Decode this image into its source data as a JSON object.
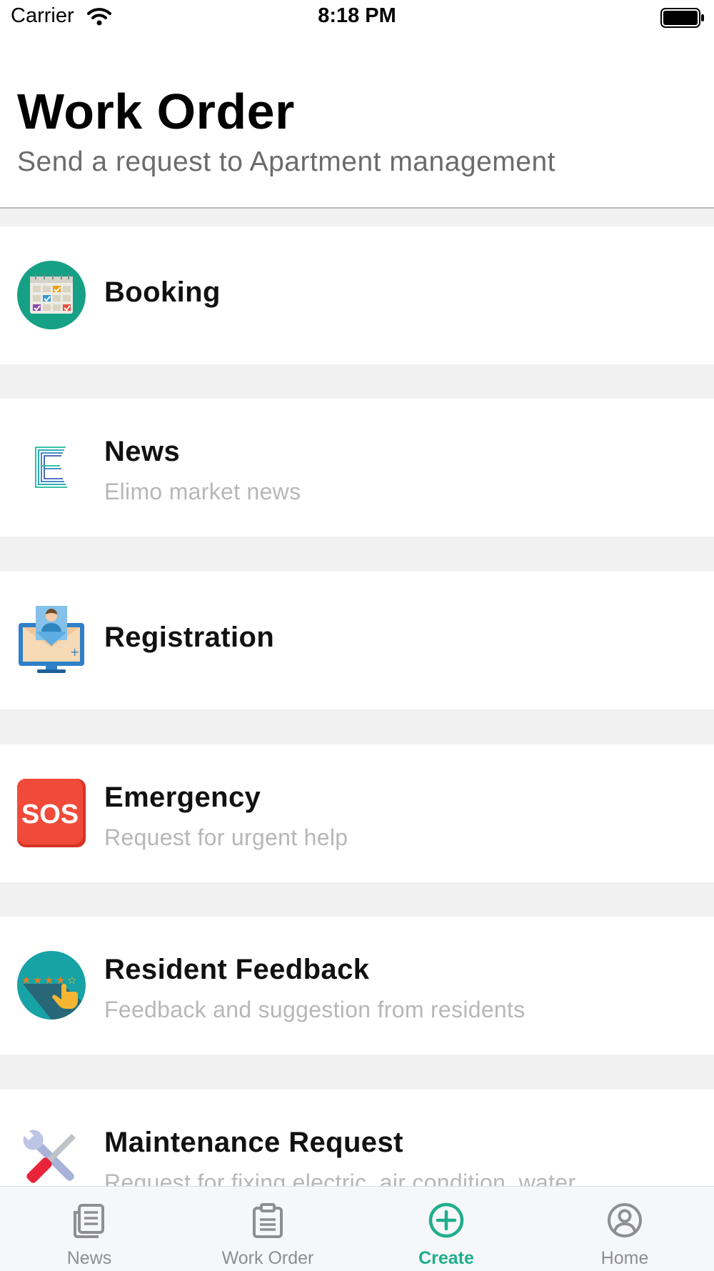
{
  "status_bar": {
    "carrier": "Carrier",
    "time": "8:18 PM"
  },
  "header": {
    "title": "Work Order",
    "subtitle": "Send a request to Apartment management"
  },
  "items": [
    {
      "title": "Booking",
      "subtitle": "",
      "icon": "calendar-icon"
    },
    {
      "title": "News",
      "subtitle": "Elimo market news",
      "icon": "elimo-logo-icon"
    },
    {
      "title": "Registration",
      "subtitle": "",
      "icon": "registration-monitor-icon"
    },
    {
      "title": "Emergency",
      "subtitle": "Request for urgent help",
      "icon": "sos-icon"
    },
    {
      "title": "Resident Feedback",
      "subtitle": "Feedback  and suggestion from residents",
      "icon": "rating-stars-icon"
    },
    {
      "title": "Maintenance Request",
      "subtitle": "Request for fixing electric, air condition, water, ...",
      "icon": "tools-icon"
    }
  ],
  "tabs": [
    {
      "label": "News",
      "icon": "newspaper-icon",
      "active": false
    },
    {
      "label": "Work Order",
      "icon": "clipboard-icon",
      "active": false
    },
    {
      "label": "Create",
      "icon": "plus-circle-icon",
      "active": true
    },
    {
      "label": "Home",
      "icon": "user-circle-icon",
      "active": false
    }
  ],
  "colors": {
    "accent": "#1fae8c",
    "tab_inactive": "#8e8e93",
    "subtitle": "#b7b7b7",
    "separator": "#f1f1f1"
  }
}
